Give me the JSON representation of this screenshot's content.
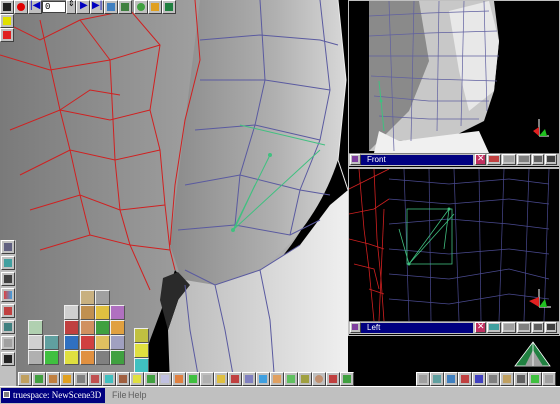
{
  "toolbar": {
    "frame_value": "0"
  },
  "viewports": {
    "front_label": "Front",
    "left_label": "Left"
  },
  "statusbar": {
    "app_title": "truespace: NewScene3D",
    "menu_file": "File",
    "menu_help": "Help"
  },
  "colors": {
    "accent": "#000080",
    "panel": "#c0c0c0",
    "wire_red": "#d02020",
    "wire_blue": "#5a5aa0",
    "wire_green": "#40c080"
  }
}
